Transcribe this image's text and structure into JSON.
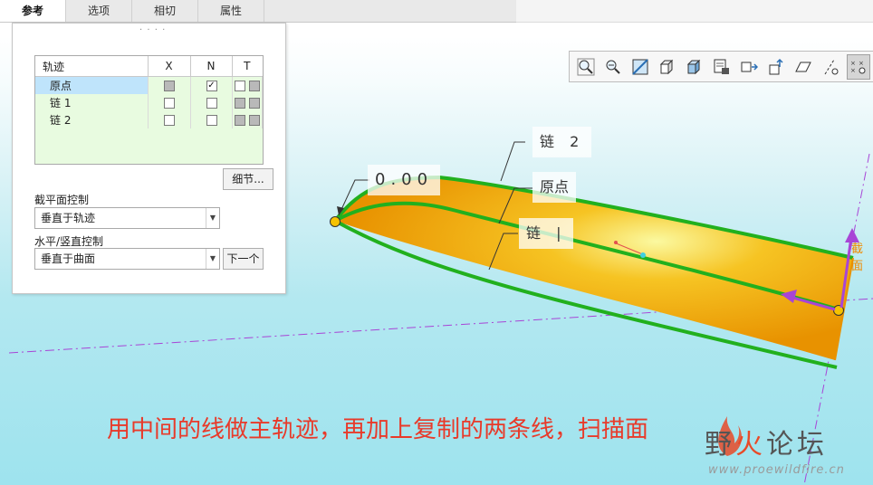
{
  "tabs": [
    {
      "label": "参考",
      "active": true
    },
    {
      "label": "选项",
      "active": false
    },
    {
      "label": "相切",
      "active": false
    },
    {
      "label": "属性",
      "active": false
    }
  ],
  "trajectory_table": {
    "headers": [
      "轨迹",
      "X",
      "N",
      "T"
    ],
    "rows": [
      {
        "name": "原点",
        "x": "grey",
        "n": "checked",
        "selected": true
      },
      {
        "name": "链 1",
        "x": "empty",
        "n": "empty",
        "selected": false
      },
      {
        "name": "链 2",
        "x": "empty",
        "n": "empty",
        "selected": false
      }
    ]
  },
  "details_button": "细节...",
  "section_plane_control": {
    "label": "截平面控制",
    "value": "垂直于轨迹"
  },
  "horizontal_vertical_control": {
    "label": "水平/竖直控制",
    "value": "垂直于曲面"
  },
  "next_button": "下一个",
  "toolbar_icons": [
    "zoom-in-icon",
    "zoom-out-icon",
    "refit-icon",
    "shaded-cube-icon",
    "display-style-icon",
    "saved-views-icon",
    "view-manager-icon",
    "spin-center-icon",
    "datum-plane-display-icon",
    "datum-axis-display-icon",
    "datum-point-display-icon"
  ],
  "model_labels": {
    "dimension": "0.00",
    "chain2": "链 2",
    "origin": "原点",
    "chain1": "链 |",
    "section_hint": "截面"
  },
  "caption": "用中间的线做主轨迹，再加上复制的两条线，扫描面",
  "logo": {
    "brand_a": "野",
    "brand_b": "火",
    "brand_c": "论坛",
    "url": "www.proewildfire.cn"
  },
  "colors": {
    "surface": "#f4a400",
    "trajectory": "#22b01e",
    "caption": "#e83a2a",
    "datum": "#a845d6"
  }
}
